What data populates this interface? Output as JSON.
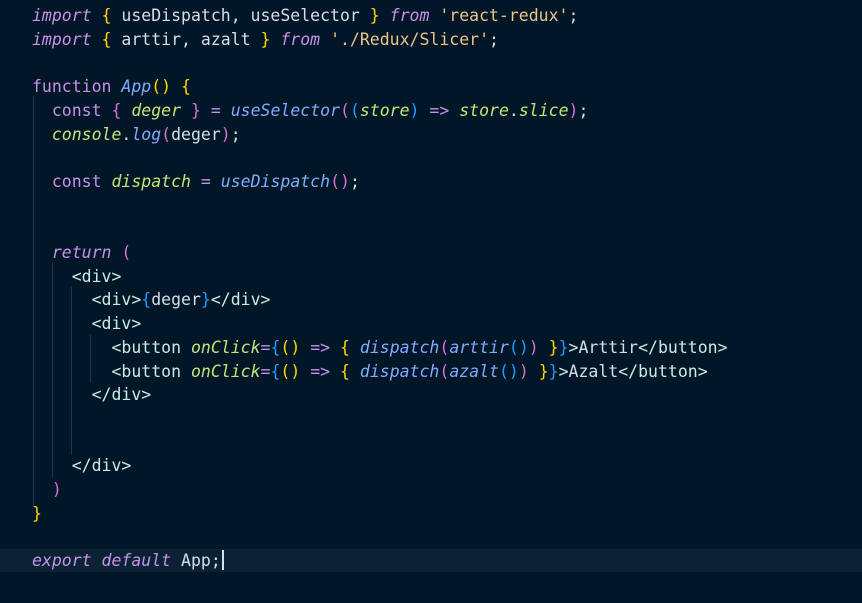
{
  "editor": {
    "language": "javascript-react",
    "theme": "night-owl",
    "lines": [
      {
        "tokens": [
          [
            "kw",
            "import"
          ],
          [
            "plain",
            " "
          ],
          [
            "b1",
            "{"
          ],
          [
            "plain",
            " useDispatch, useSelector "
          ],
          [
            "b1",
            "}"
          ],
          [
            "plain",
            " "
          ],
          [
            "kw",
            "from"
          ],
          [
            "plain",
            " "
          ],
          [
            "str",
            "'react-redux'"
          ],
          [
            "plain",
            ";"
          ]
        ]
      },
      {
        "tokens": [
          [
            "kw",
            "import"
          ],
          [
            "plain",
            " "
          ],
          [
            "b1",
            "{"
          ],
          [
            "plain",
            " arttir, azalt "
          ],
          [
            "b1",
            "}"
          ],
          [
            "plain",
            " "
          ],
          [
            "kw",
            "from"
          ],
          [
            "plain",
            " "
          ],
          [
            "str",
            "'./Redux/Slicer'"
          ],
          [
            "plain",
            ";"
          ]
        ]
      },
      {
        "tokens": []
      },
      {
        "tokens": [
          [
            "fn",
            "function"
          ],
          [
            "plain",
            " "
          ],
          [
            "fni",
            "App"
          ],
          [
            "b1",
            "()"
          ],
          [
            "plain",
            " "
          ],
          [
            "b1",
            "{"
          ]
        ]
      },
      {
        "tokens": [
          [
            "plain",
            "  "
          ],
          [
            "fn",
            "const"
          ],
          [
            "plain",
            " "
          ],
          [
            "b2",
            "{"
          ],
          [
            "plain",
            " "
          ],
          [
            "var",
            "deger"
          ],
          [
            "plain",
            " "
          ],
          [
            "b2",
            "}"
          ],
          [
            "plain",
            " "
          ],
          [
            "op",
            "="
          ],
          [
            "plain",
            " "
          ],
          [
            "fni",
            "useSelector"
          ],
          [
            "b2",
            "("
          ],
          [
            "b3",
            "("
          ],
          [
            "var",
            "store"
          ],
          [
            "b3",
            ")"
          ],
          [
            "plain",
            " "
          ],
          [
            "op",
            "=>"
          ],
          [
            "plain",
            " "
          ],
          [
            "var",
            "store"
          ],
          [
            "plain",
            "."
          ],
          [
            "var",
            "slice"
          ],
          [
            "b2",
            ")"
          ],
          [
            "plain",
            ";"
          ]
        ]
      },
      {
        "tokens": [
          [
            "plain",
            "  "
          ],
          [
            "var",
            "console"
          ],
          [
            "plain",
            "."
          ],
          [
            "fni",
            "log"
          ],
          [
            "b2",
            "("
          ],
          [
            "plain",
            "deger"
          ],
          [
            "b2",
            ")"
          ],
          [
            "plain",
            ";"
          ]
        ]
      },
      {
        "tokens": []
      },
      {
        "tokens": [
          [
            "plain",
            "  "
          ],
          [
            "fn",
            "const"
          ],
          [
            "plain",
            " "
          ],
          [
            "var",
            "dispatch"
          ],
          [
            "plain",
            " "
          ],
          [
            "op",
            "="
          ],
          [
            "plain",
            " "
          ],
          [
            "fni",
            "useDispatch"
          ],
          [
            "b2",
            "()"
          ],
          [
            "plain",
            ";"
          ]
        ]
      },
      {
        "tokens": []
      },
      {
        "tokens": []
      },
      {
        "tokens": [
          [
            "plain",
            "  "
          ],
          [
            "kw",
            "return"
          ],
          [
            "plain",
            " "
          ],
          [
            "b2",
            "("
          ]
        ]
      },
      {
        "tokens": [
          [
            "plain",
            "    "
          ],
          [
            "tag",
            "<div>"
          ]
        ]
      },
      {
        "tokens": [
          [
            "plain",
            "      "
          ],
          [
            "tag",
            "<div>"
          ],
          [
            "b3",
            "{"
          ],
          [
            "plain",
            "deger"
          ],
          [
            "b3",
            "}"
          ],
          [
            "tag",
            "</div>"
          ]
        ]
      },
      {
        "tokens": [
          [
            "plain",
            "      "
          ],
          [
            "tag",
            "<div>"
          ]
        ]
      },
      {
        "tokens": [
          [
            "plain",
            "        "
          ],
          [
            "tag",
            "<button"
          ],
          [
            "plain",
            " "
          ],
          [
            "attr",
            "onClick"
          ],
          [
            "op",
            "="
          ],
          [
            "b3",
            "{"
          ],
          [
            "b1",
            "()"
          ],
          [
            "plain",
            " "
          ],
          [
            "op",
            "=>"
          ],
          [
            "plain",
            " "
          ],
          [
            "b1",
            "{"
          ],
          [
            "plain",
            " "
          ],
          [
            "fni",
            "dispatch"
          ],
          [
            "b2",
            "("
          ],
          [
            "fni",
            "arttir"
          ],
          [
            "b3",
            "()"
          ],
          [
            "b2",
            ")"
          ],
          [
            "plain",
            " "
          ],
          [
            "b1",
            "}"
          ],
          [
            "b3",
            "}"
          ],
          [
            "tag",
            ">"
          ],
          [
            "plain",
            "Arttir"
          ],
          [
            "tag",
            "</button>"
          ]
        ]
      },
      {
        "tokens": [
          [
            "plain",
            "        "
          ],
          [
            "tag",
            "<button"
          ],
          [
            "plain",
            " "
          ],
          [
            "attr",
            "onClick"
          ],
          [
            "op",
            "="
          ],
          [
            "b3",
            "{"
          ],
          [
            "b1",
            "()"
          ],
          [
            "plain",
            " "
          ],
          [
            "op",
            "=>"
          ],
          [
            "plain",
            " "
          ],
          [
            "b1",
            "{"
          ],
          [
            "plain",
            " "
          ],
          [
            "fni",
            "dispatch"
          ],
          [
            "b2",
            "("
          ],
          [
            "fni",
            "azalt"
          ],
          [
            "b3",
            "()"
          ],
          [
            "b2",
            ")"
          ],
          [
            "plain",
            " "
          ],
          [
            "b1",
            "}"
          ],
          [
            "b3",
            "}"
          ],
          [
            "tag",
            ">"
          ],
          [
            "plain",
            "Azalt"
          ],
          [
            "tag",
            "</button>"
          ]
        ]
      },
      {
        "tokens": [
          [
            "plain",
            "      "
          ],
          [
            "tag",
            "</div>"
          ]
        ]
      },
      {
        "tokens": []
      },
      {
        "tokens": []
      },
      {
        "tokens": [
          [
            "plain",
            "    "
          ],
          [
            "tag",
            "</div>"
          ]
        ]
      },
      {
        "tokens": [
          [
            "plain",
            "  "
          ],
          [
            "b2",
            ")"
          ]
        ]
      },
      {
        "tokens": [
          [
            "b1",
            "}"
          ]
        ]
      },
      {
        "tokens": []
      },
      {
        "tokens": [
          [
            "kw",
            "export"
          ],
          [
            "plain",
            " "
          ],
          [
            "kw",
            "default"
          ],
          [
            "plain",
            " App;"
          ]
        ]
      }
    ]
  }
}
